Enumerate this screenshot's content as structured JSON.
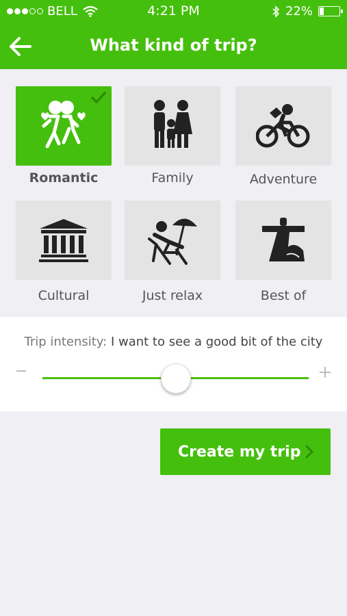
{
  "status_bar": {
    "carrier": "BELL",
    "time": "4:21 PM",
    "battery": "22%",
    "battery_level": 0.22,
    "signal_bars_filled": 3,
    "signal_bars_total": 5
  },
  "header": {
    "title": "What kind of trip?",
    "back_icon": "arrow-left-icon"
  },
  "trip_types": [
    {
      "label": "Romantic",
      "icon": "couple-icon",
      "selected": true
    },
    {
      "label": "Family",
      "icon": "family-icon",
      "selected": false
    },
    {
      "label": "Adventure",
      "icon": "cyclist-icon",
      "selected": false
    },
    {
      "label": "Cultural",
      "icon": "museum-icon",
      "selected": false
    },
    {
      "label": "Just relax",
      "icon": "beach-chair-icon",
      "selected": false
    },
    {
      "label": "Best of",
      "icon": "landmark-statue-icon",
      "selected": false
    }
  ],
  "intensity": {
    "label": "Trip intensity:",
    "value_text": "I want to see a good bit of the city",
    "level": 0.5
  },
  "create_button": {
    "label": "Create my trip"
  },
  "colors": {
    "accent": "#45bf0d",
    "tile_bg": "#e4e4e4",
    "page_bg": "#efeff4"
  }
}
